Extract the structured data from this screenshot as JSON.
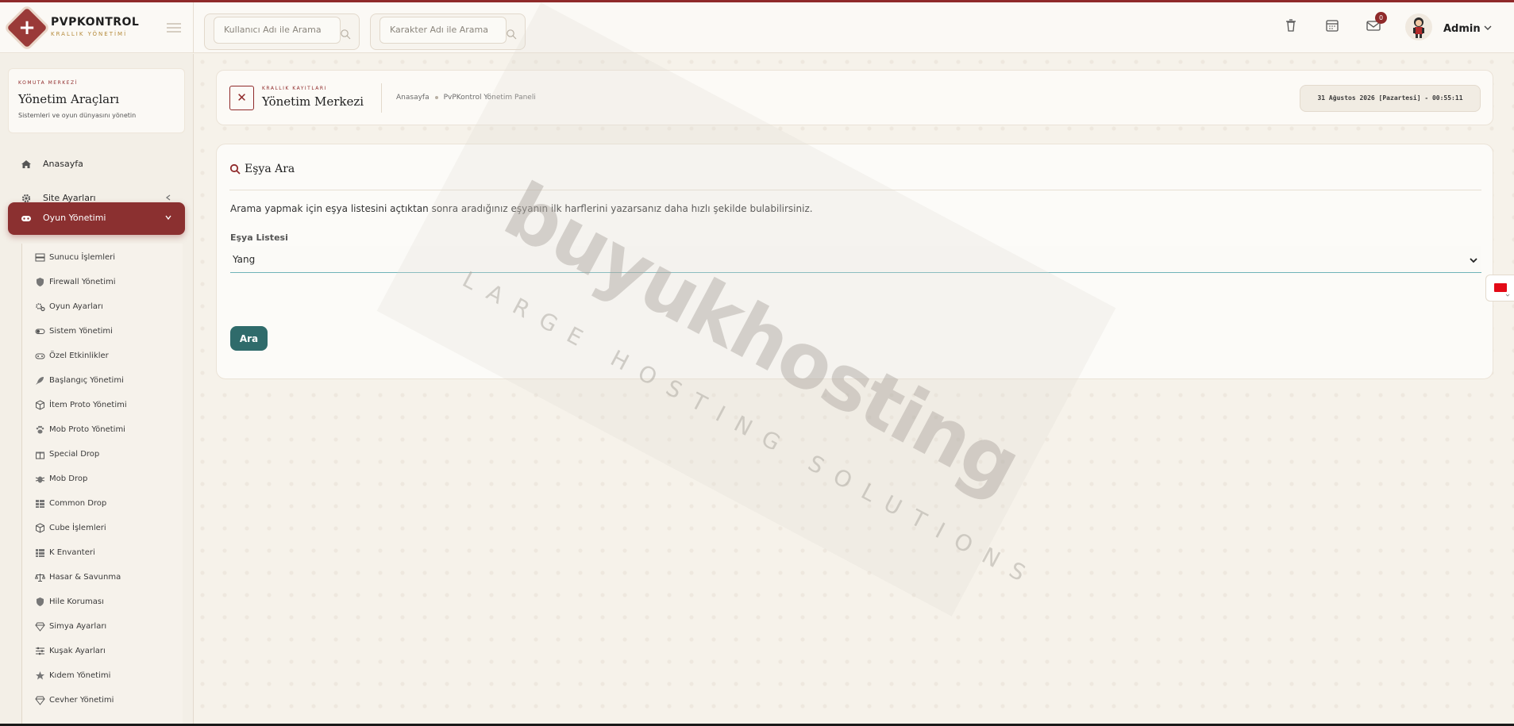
{
  "brand": {
    "name": "PVPKONTROL",
    "tagline": "KRALLIK YÖNETİMİ"
  },
  "header": {
    "search_user_placeholder": "Kullanıcı Adı ile Arama",
    "search_char_placeholder": "Karakter Adı ile Arama",
    "mail_badge": "0",
    "admin_name": "Admin"
  },
  "sidebar": {
    "card_eyebrow": "KOMUTA MERKEZİ",
    "card_title": "Yönetim Araçları",
    "card_subtitle": "Sistemleri ve oyun dünyasını yönetin",
    "nav": [
      {
        "label": "Anasayfa",
        "icon": "home-icon"
      },
      {
        "label": "Site Ayarları",
        "icon": "gear-icon"
      },
      {
        "label": "Oyun Yönetimi",
        "icon": "gamepad-icon"
      }
    ],
    "submenu": [
      {
        "label": "Sunucu İşlemleri",
        "icon": "server-icon"
      },
      {
        "label": "Firewall Yönetimi",
        "icon": "shield-icon"
      },
      {
        "label": "Oyun Ayarları",
        "icon": "cogs-icon"
      },
      {
        "label": "Sistem Yönetimi",
        "icon": "toggle-icon"
      },
      {
        "label": "Özel Etkinlikler",
        "icon": "gamepad-icon"
      },
      {
        "label": "Başlangıç Yönetimi",
        "icon": "rocket-icon"
      },
      {
        "label": "İtem Proto Yönetimi",
        "icon": "cube-icon"
      },
      {
        "label": "Mob Proto Yönetimi",
        "icon": "paw-icon"
      },
      {
        "label": "Special Drop",
        "icon": "gift-icon"
      },
      {
        "label": "Mob Drop",
        "icon": "bug-icon"
      },
      {
        "label": "Common Drop",
        "icon": "grid-icon"
      },
      {
        "label": "Cube İşlemleri",
        "icon": "cube-icon"
      },
      {
        "label": "K Envanteri",
        "icon": "list-icon"
      },
      {
        "label": "Hasar & Savunma",
        "icon": "scale-icon"
      },
      {
        "label": "Hile Koruması",
        "icon": "shield-icon"
      },
      {
        "label": "Simya Ayarları",
        "icon": "gem-icon"
      },
      {
        "label": "Kuşak Ayarları",
        "icon": "sliders-icon"
      },
      {
        "label": "Kıdem Yönetimi",
        "icon": "star-icon"
      },
      {
        "label": "Cevher Yönetimi",
        "icon": "gem-icon"
      }
    ]
  },
  "breadcrumb": {
    "eyebrow": "KRALLIK KAYITLARI",
    "title": "Yönetim Merkezi",
    "path_home": "Anasayfa",
    "path_current": "PvPKontrol Yönetim Paneli",
    "datetime": "31 Ağustos 2026 [Pazartesi] - 00:55:11"
  },
  "search_card": {
    "title": "Eşya Ara",
    "description": "Arama yapmak için eşya listesini açtıktan sonra aradığınız eşyanın ilk harflerini yazarsanız daha hızlı şekilde bulabilirsiniz.",
    "list_label": "Eşya Listesi",
    "selected_item": "Yang",
    "button_label": "Ara"
  },
  "watermark": {
    "main": "buyukhosting",
    "sub": "LARGE HOSTING SOLUTIONS"
  },
  "colors": {
    "accent": "#8f2a2a",
    "button": "#2f6b6b",
    "background": "#f6f2ea"
  }
}
